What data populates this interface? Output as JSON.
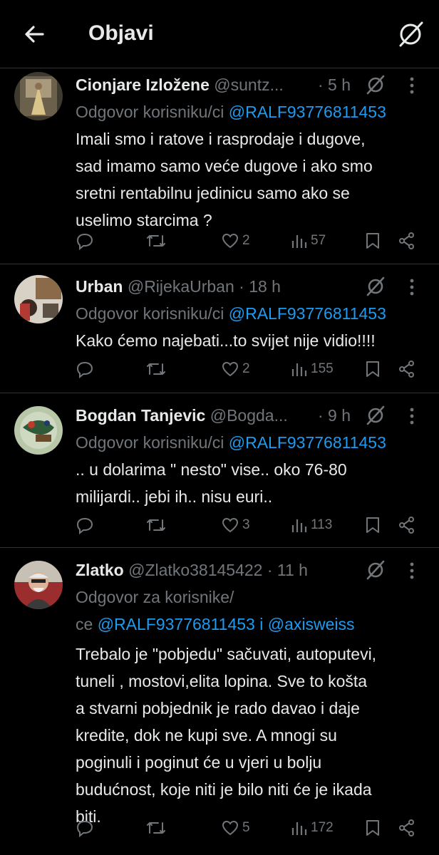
{
  "header": {
    "title": "Objavi"
  },
  "tweets": [
    {
      "name": "Cionjare Izložene",
      "handle": "@suntz...",
      "time": "· 5 h",
      "reply_prefix": "Odgovor korisniku/ci",
      "reply_mention": "@RALF93776811453",
      "text_lines": [
        "Imali smo i ratove i rasprodaje i dugove,",
        "sad imamo samo veće dugove i ako smo",
        "sretni rentabilnu jedinicu samo ako se",
        "uselimo starcima ?"
      ],
      "likes": "2",
      "views": "57",
      "avatar_color": "#8b7a5c"
    },
    {
      "name": "Urban",
      "handle": "@RijekaUrban",
      "time": "· 18 h",
      "reply_prefix": "Odgovor korisniku/ci",
      "reply_mention": "@RALF93776811453",
      "text_lines": [
        "Kako ćemo najebati...to svijet nije vidio!!!!"
      ],
      "likes": "2",
      "views": "155",
      "avatar_color": "#c2b9a8"
    },
    {
      "name": "Bogdan Tanjevic",
      "handle": "@Bogda...",
      "time": "· 9 h",
      "reply_prefix": "Odgovor korisniku/ci",
      "reply_mention": "@RALF93776811453",
      "text_lines": [
        ".. u dolarima \" nesto\" vise.. oko 76-80",
        "milijardi.. jebi ih.. nisu euri.."
      ],
      "likes": "3",
      "views": "113",
      "avatar_color": "#7a9a78"
    },
    {
      "name": "Zlatko",
      "handle": "@Zlatko38145422",
      "time": "· 11 h",
      "reply_prefix_line1": "Odgovor za korisnike/",
      "reply_prefix_line2": "ce",
      "reply_mention": "@RALF93776811453",
      "reply_and": "i",
      "reply_mention2": "@axisweiss",
      "text_lines": [
        "Trebalo je \"pobjedu\" sačuvati, autoputevi,",
        "tuneli , mostovi,elita lopina. Sve to košta",
        "a stvarni pobjednik je rado davao i daje",
        "kredite, dok ne kupi sve. A mnogi su",
        "poginuli i poginut će u vjeri u bolju",
        "budućnost, koje niti je bilo niti će je ikada",
        "biti."
      ],
      "likes": "5",
      "views": "172",
      "avatar_color": "#a63a3a"
    }
  ],
  "colors": {
    "background": "#000000",
    "text": "#e7e9ea",
    "muted": "#71767b",
    "link": "#1d9bf0",
    "divider": "#2f3336"
  },
  "icons": [
    "back-arrow-icon",
    "grok-icon",
    "more-icon",
    "reply-icon",
    "retweet-icon",
    "like-icon",
    "views-icon",
    "bookmark-icon",
    "share-icon"
  ]
}
